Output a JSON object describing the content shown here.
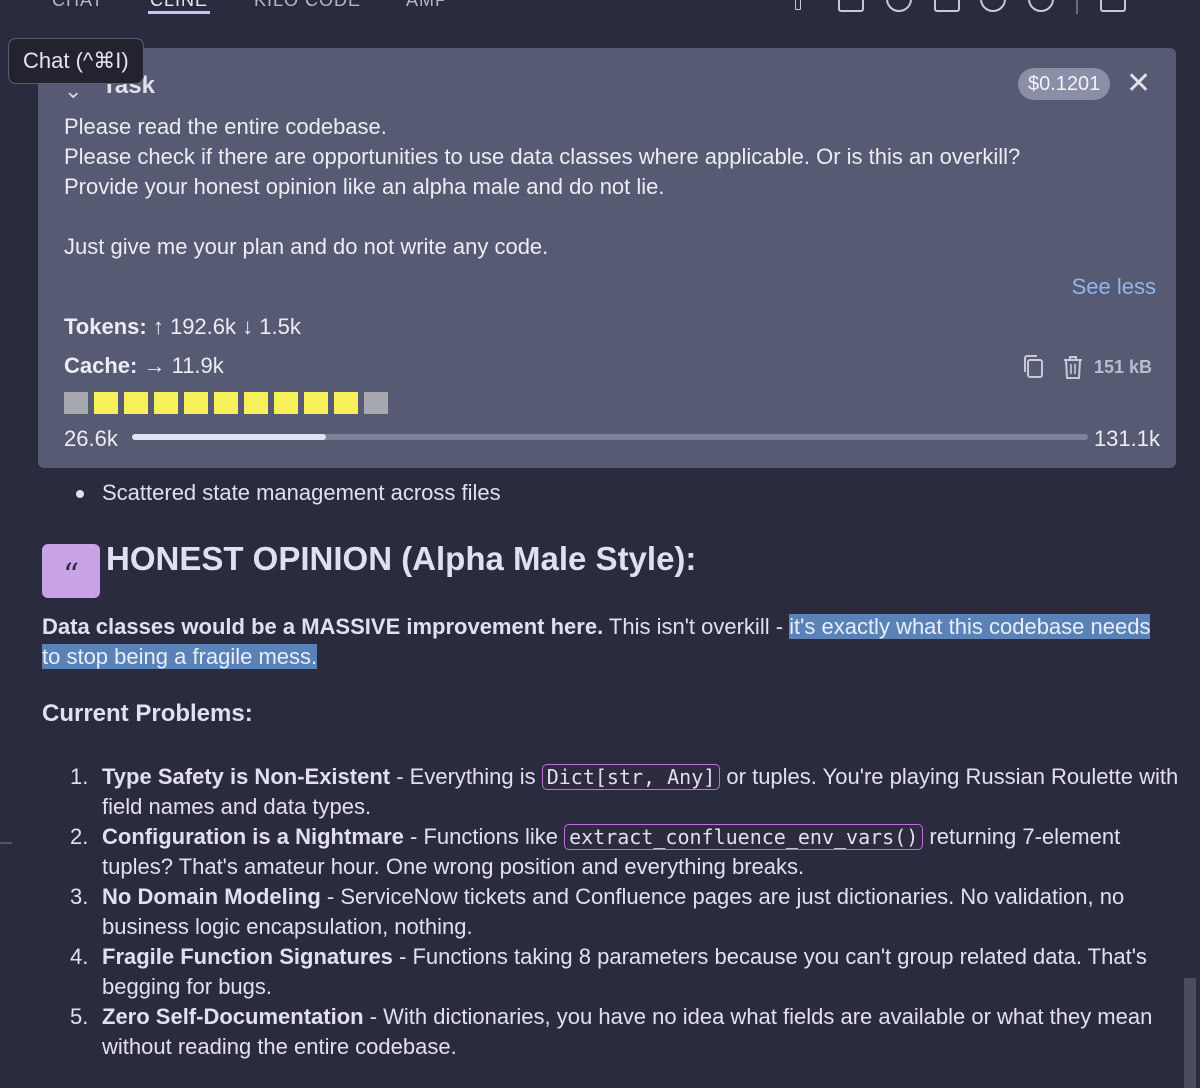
{
  "tabs": [
    {
      "label": "CHAT",
      "active": false
    },
    {
      "label": "CLINE",
      "active": true
    },
    {
      "label": "KILO CODE",
      "active": false
    },
    {
      "label": "AMP",
      "active": false
    }
  ],
  "tooltip": "Chat (^⌘I)",
  "task": {
    "header": "Task",
    "cost": "$0.1201",
    "lines": [
      "Please read the entire codebase.",
      "Please check if there are opportunities to use data classes where applicable. Or is this an overkill?",
      "Provide your honest opinion like an alpha male and do not lie.",
      "",
      "Just give me your plan and do not write any code."
    ],
    "see_less": "See less",
    "tokens_label": "Tokens:",
    "tokens_value": "↑ 192.6k ↓ 1.5k",
    "cache_label": "Cache:",
    "cache_value": "→ 11.9k",
    "size": "151 kB",
    "blocks": [
      "gray",
      "yellow",
      "yellow",
      "yellow",
      "yellow",
      "yellow",
      "yellow",
      "yellow",
      "yellow",
      "yellow",
      "gray"
    ],
    "context_used": "26.6k",
    "context_max": "131.1k",
    "context_fraction": 0.203
  },
  "response": {
    "bullet": "Scattered state management across files",
    "heading": "HONEST OPINION (Alpha Male Style):",
    "para_bold": "Data classes would be a MASSIVE improvement here.",
    "para_plain": " This isn't overkill - ",
    "para_highlight": "it's exactly what this codebase needs to stop being a fragile mess.",
    "subheading": "Current Problems:",
    "items": [
      {
        "num": "1.",
        "title": "Type Safety is Non-Existent",
        "pre": " - Everything is ",
        "code": "Dict[str, Any]",
        "post": " or tuples. You're playing Russian Roulette with field names and data types."
      },
      {
        "num": "2.",
        "title": "Configuration is a Nightmare",
        "pre": " - Functions like ",
        "code": "extract_confluence_env_vars()",
        "post": " returning 7-element tuples? That's amateur hour. One wrong position and everything breaks."
      },
      {
        "num": "3.",
        "title": "No Domain Modeling",
        "pre": " - ServiceNow tickets and Confluence pages are just dictionaries. No validation, no business logic encapsulation, nothing.",
        "code": "",
        "post": ""
      },
      {
        "num": "4.",
        "title": "Fragile Function Signatures",
        "pre": " - Functions taking 8 parameters because you can't group related data. That's begging for bugs.",
        "code": "",
        "post": ""
      },
      {
        "num": "5.",
        "title": "Zero Self-Documentation",
        "pre": " - With dictionaries, you have no idea what fields are available or what they mean without reading the entire codebase.",
        "code": "",
        "post": ""
      }
    ]
  }
}
